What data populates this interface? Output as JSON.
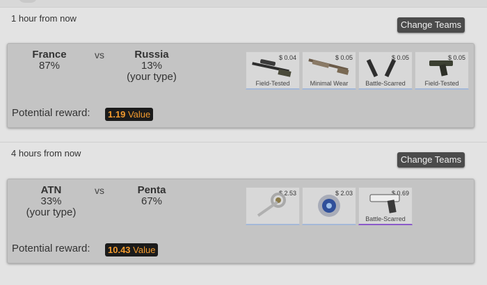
{
  "matches": [
    {
      "time": "1 hour from now",
      "change_button": "Change Teams",
      "team1": {
        "name": "France",
        "percent": "87%",
        "note": ""
      },
      "vs": "vs",
      "team2": {
        "name": "Russia",
        "percent": "13%",
        "note": "(your type)"
      },
      "reward_label": "Potential reward:",
      "reward_amount": "1.19",
      "reward_unit": "Value",
      "items": [
        {
          "icon": "sniper-rifle-icon",
          "price": "$ 0.04",
          "wear": "Field-Tested",
          "rarity_color": "#a4b8d8"
        },
        {
          "icon": "shotgun-icon",
          "price": "$ 0.05",
          "wear": "Minimal Wear",
          "rarity_color": "#a4b8d8"
        },
        {
          "icon": "dual-pistols-icon",
          "price": "$ 0.05",
          "wear": "Battle-Scarred",
          "rarity_color": "#a4b8d8"
        },
        {
          "icon": "pistol-icon",
          "price": "$ 0.05",
          "wear": "Field-Tested",
          "rarity_color": "#a4b8d8"
        }
      ]
    },
    {
      "time": "4 hours from now",
      "change_button": "Change Teams",
      "team1": {
        "name": "ATN",
        "percent": "33%",
        "note": "(your type)"
      },
      "vs": "vs",
      "team2": {
        "name": "Penta",
        "percent": "67%",
        "note": ""
      },
      "reward_label": "Potential reward:",
      "reward_amount": "10.43",
      "reward_unit": "Value",
      "items": [
        {
          "icon": "key-icon",
          "price": "$ 2.53",
          "wear": "",
          "rarity_color": "#a4b8d8"
        },
        {
          "icon": "sticker-icon",
          "price": "$ 2.03",
          "wear": "",
          "rarity_color": "#a4b8d8"
        },
        {
          "icon": "desert-eagle-icon",
          "price": "$ 0.69",
          "wear": "Battle-Scarred",
          "rarity_color": "#8a5ac8"
        }
      ]
    }
  ]
}
